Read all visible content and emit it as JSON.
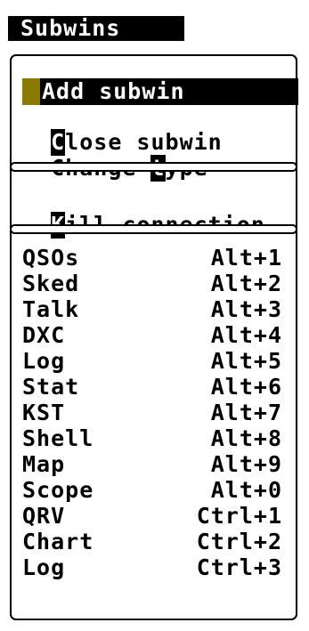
{
  "menu": {
    "title": "Subwins",
    "section1": [
      {
        "label": "Add subwin",
        "selected": true
      },
      {
        "hotkey": "C",
        "rest": "lose subwin"
      },
      {
        "before": "Change ",
        "hotkey": "t",
        "after": "ype"
      }
    ],
    "section2": [
      {
        "hotkey": "K",
        "rest": "ill connection"
      }
    ],
    "windows": [
      {
        "name": "QSOs",
        "shortcut": "Alt+1"
      },
      {
        "name": "Sked",
        "shortcut": "Alt+2"
      },
      {
        "name": "Talk",
        "shortcut": "Alt+3"
      },
      {
        "name": "DXC",
        "shortcut": "Alt+4"
      },
      {
        "name": "Log",
        "shortcut": "Alt+5"
      },
      {
        "name": "Stat",
        "shortcut": "Alt+6"
      },
      {
        "name": "KST",
        "shortcut": "Alt+7"
      },
      {
        "name": "Shell",
        "shortcut": "Alt+8"
      },
      {
        "name": "Map",
        "shortcut": "Alt+9"
      },
      {
        "name": "Scope",
        "shortcut": "Alt+0"
      },
      {
        "name": "QRV",
        "shortcut": "Ctrl+1"
      },
      {
        "name": "Chart",
        "shortcut": "Ctrl+2"
      },
      {
        "name": "Log",
        "shortcut": "Ctrl+3"
      }
    ]
  },
  "colors": {
    "foreground": "#000000",
    "background": "#ffffff",
    "cursor_marker": "#8a7a00"
  }
}
